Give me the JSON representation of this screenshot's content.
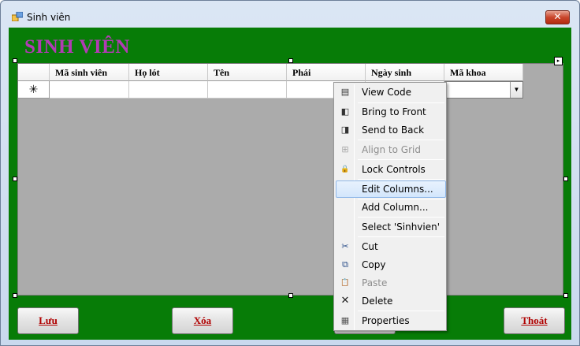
{
  "window": {
    "title": "Sinh viên",
    "close_label": "✕"
  },
  "form": {
    "header": "SINH VIÊN"
  },
  "grid": {
    "columns": [
      "Mã sinh viên",
      "Họ lót",
      "Tên",
      "Phái",
      "Ngày sinh",
      "Mã khoa"
    ],
    "new_row_marker": "✳"
  },
  "buttons": {
    "save": "Lưu",
    "delete": "Xóa",
    "exit": "Thoát"
  },
  "context_menu": {
    "items": [
      {
        "label": "View Code",
        "icon": "view-code-icon",
        "glyph": "▤",
        "enabled": true
      },
      {
        "label": "Bring to Front",
        "icon": "bring-to-front-icon",
        "glyph": "◧",
        "enabled": true
      },
      {
        "label": "Send to Back",
        "icon": "send-to-back-icon",
        "glyph": "◨",
        "enabled": true
      },
      {
        "label": "Align to Grid",
        "icon": "align-to-grid-icon",
        "glyph": "⊞",
        "enabled": false
      },
      {
        "label": "Lock Controls",
        "icon": "lock-icon",
        "glyph": "🔒",
        "enabled": true
      },
      {
        "label": "Edit Columns...",
        "icon": "",
        "glyph": "",
        "enabled": true,
        "highlighted": true
      },
      {
        "label": "Add Column...",
        "icon": "",
        "glyph": "",
        "enabled": true
      },
      {
        "label": "Select 'Sinhvien'",
        "icon": "",
        "glyph": "",
        "enabled": true
      },
      {
        "label": "Cut",
        "icon": "scissors-icon",
        "glyph": "✂",
        "enabled": true
      },
      {
        "label": "Copy",
        "icon": "copy-icon",
        "glyph": "⧉",
        "enabled": true
      },
      {
        "label": "Paste",
        "icon": "paste-icon",
        "glyph": "📋",
        "enabled": false
      },
      {
        "label": "Delete",
        "icon": "delete-icon",
        "glyph": "✕",
        "enabled": true
      },
      {
        "label": "Properties",
        "icon": "properties-icon",
        "glyph": "▦",
        "enabled": true
      }
    ]
  }
}
